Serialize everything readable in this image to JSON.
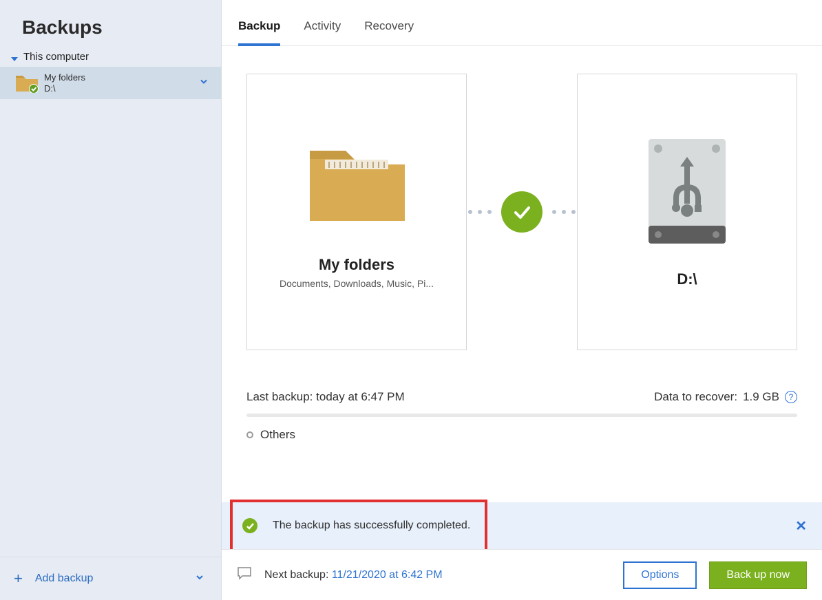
{
  "sidebar": {
    "title": "Backups",
    "section_label": "This computer",
    "item": {
      "title": "My folders",
      "sub": "D:\\"
    },
    "add_label": "Add backup"
  },
  "tabs": {
    "backup": "Backup",
    "activity": "Activity",
    "recovery": "Recovery"
  },
  "source_card": {
    "title": "My folders",
    "sub": "Documents, Downloads, Music, Pi..."
  },
  "dest_card": {
    "title": "D:\\"
  },
  "info": {
    "last_label": "Last backup:",
    "last_value": "today at 6:47 PM",
    "recover_label": "Data to recover:",
    "recover_value": "1.9 GB"
  },
  "others_label": "Others",
  "status_message": "The backup has successfully completed.",
  "footer": {
    "next_label": "Next backup:",
    "next_value": "11/21/2020 at 6:42 PM",
    "options": "Options",
    "backup_now": "Back up now"
  }
}
